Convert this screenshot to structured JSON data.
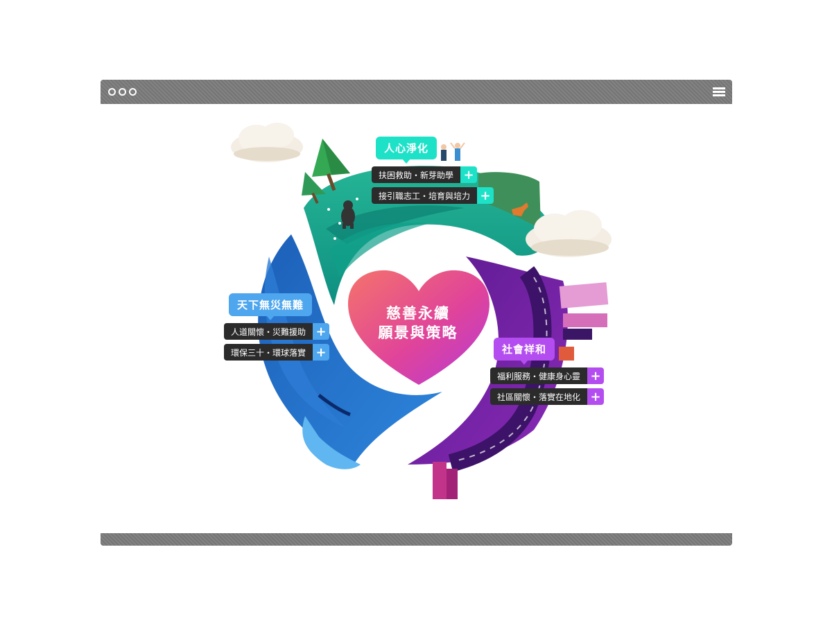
{
  "window": {
    "title_dots": 3,
    "menu_icon": "hamburger-icon"
  },
  "center": {
    "line1": "慈善永續",
    "line2": "願景與策略"
  },
  "sections": {
    "top": {
      "title": "人心淨化",
      "color": "#1de2c8",
      "items": [
        "扶困救助・新芽助學",
        "接引職志工・培育與培力"
      ]
    },
    "left": {
      "title": "天下無災無難",
      "color": "#4ea6ee",
      "items": [
        "人道關懷・災難援助",
        "環保三十・環球落實"
      ]
    },
    "right": {
      "title": "社會祥和",
      "color": "#b44df0",
      "items": [
        "福利服務・健康身心靈",
        "社區關懷・落實在地化"
      ]
    }
  },
  "colors": {
    "chrome": "#7b7b7b",
    "green": "#14a58e",
    "blue": "#1f63c4",
    "purple": "#6a1f9e",
    "heart_from": "#f4736b",
    "heart_to": "#c63fd1"
  }
}
